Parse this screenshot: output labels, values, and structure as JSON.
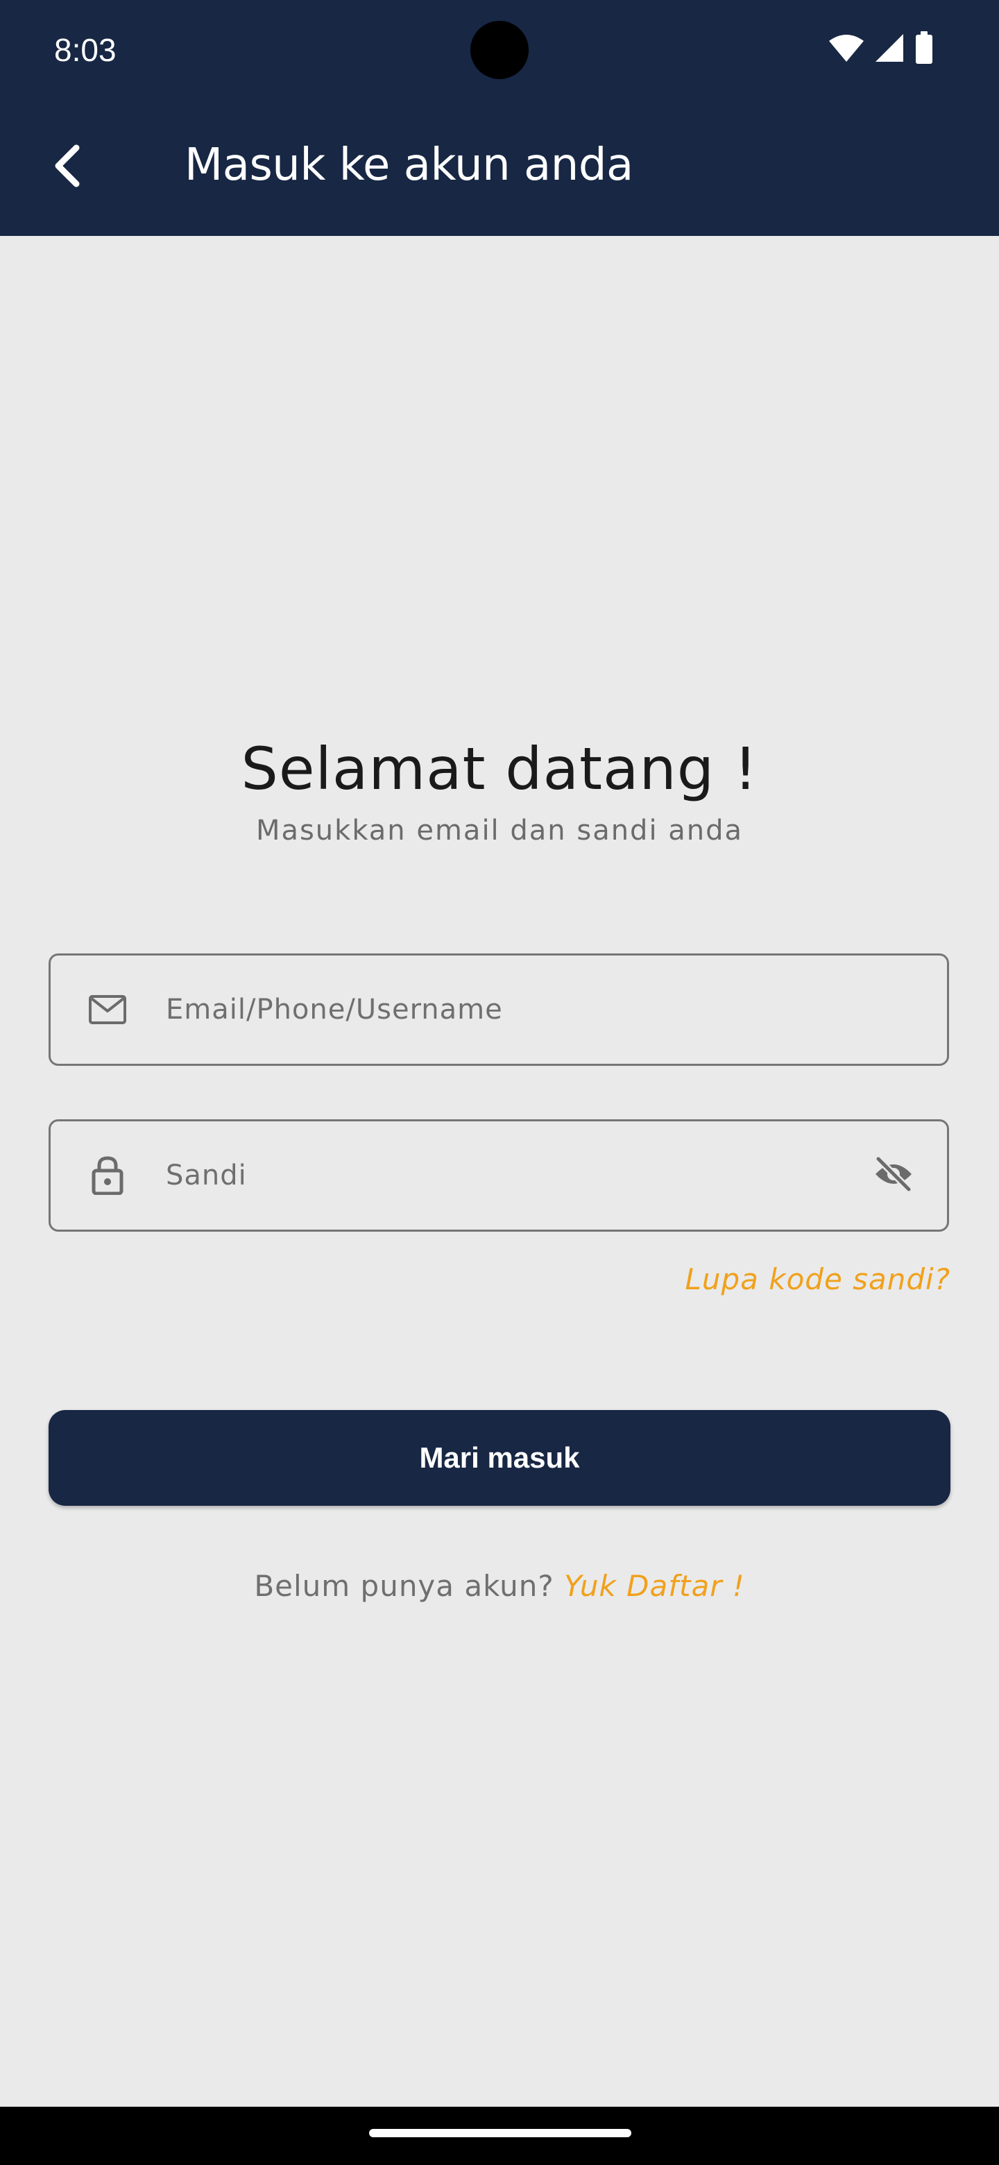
{
  "status_bar": {
    "time": "8:03",
    "icons": [
      "wifi-icon",
      "cellular-signal-icon",
      "battery-icon"
    ]
  },
  "app_bar": {
    "back_icon": "chevron-left-icon",
    "title": "Masuk ke akun anda"
  },
  "welcome": {
    "title": "Selamat datang !",
    "subtitle": "Masukkan email dan sandi anda"
  },
  "form": {
    "email_placeholder": "Email/Phone/Username",
    "email_icon": "mail-icon",
    "password_placeholder": "Sandi",
    "password_icon": "lock-icon",
    "visibility_icon": "eye-off-icon",
    "forgot_label": "Lupa kode sandi?"
  },
  "login_button": {
    "label": "Mari masuk"
  },
  "register": {
    "prompt": "Belum punya akun?",
    "link": "Yuk Daftar !"
  },
  "colors": {
    "primary": "#172744",
    "accent": "#F0A11C",
    "background": "#EAEAEA"
  }
}
